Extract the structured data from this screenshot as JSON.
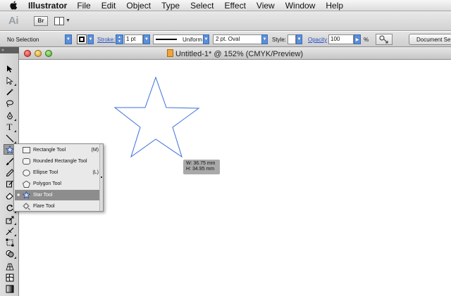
{
  "menubar": {
    "app_name": "Illustrator",
    "items": [
      "File",
      "Edit",
      "Object",
      "Type",
      "Select",
      "Effect",
      "View",
      "Window",
      "Help"
    ]
  },
  "appbar": {
    "logo": "Ai",
    "bridge": "Br"
  },
  "control": {
    "selection": "No Selection",
    "stroke_label": "Stroke:",
    "stroke_weight": "1 pt",
    "profile": "Uniform",
    "brush": "2 pt. Oval",
    "style_label": "Style:",
    "opacity_label": "Opacity",
    "opacity_value": "100",
    "percent": "%",
    "document_setup": "Document Setup"
  },
  "document": {
    "title": "Untitled-1* @ 152% (CMYK/Preview)"
  },
  "flyout": {
    "items": [
      {
        "label": "Rectangle Tool",
        "shortcut": "(M)",
        "icon": "rectangle-icon",
        "selected": false
      },
      {
        "label": "Rounded Rectangle Tool",
        "shortcut": "",
        "icon": "rounded-rectangle-icon",
        "selected": false
      },
      {
        "label": "Ellipse Tool",
        "shortcut": "(L)",
        "icon": "ellipse-icon",
        "selected": false
      },
      {
        "label": "Polygon Tool",
        "shortcut": "",
        "icon": "polygon-icon",
        "selected": false
      },
      {
        "label": "Star Tool",
        "shortcut": "",
        "icon": "star-icon",
        "selected": true
      },
      {
        "label": "Flare Tool",
        "shortcut": "",
        "icon": "flare-icon",
        "selected": false
      }
    ]
  },
  "measure": {
    "width": "W: 36.75 mm",
    "height": "H: 34.95 mm"
  },
  "colors": {
    "accent": "#2b51c8",
    "star_stroke": "#3a6fdc",
    "selection_row": "#8d8d8d"
  }
}
